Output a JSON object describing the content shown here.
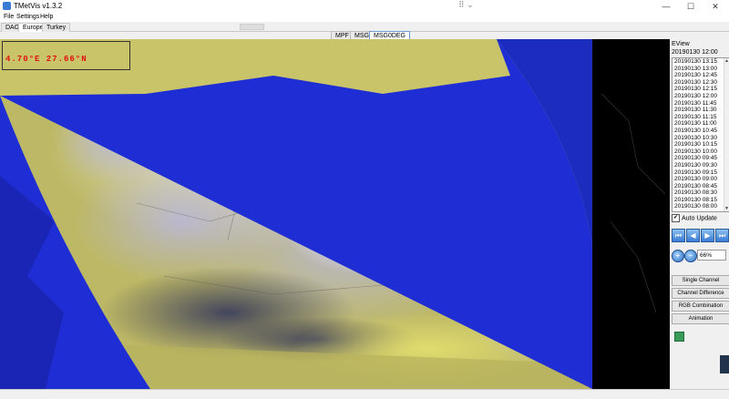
{
  "window": {
    "title": "TMetVis v1.3.2",
    "grip_glyph": "⠿ ⌄",
    "controls": {
      "minimize": "—",
      "maximize": "☐",
      "close": "✕"
    }
  },
  "menu": {
    "items": [
      "File",
      "Settings",
      "Help"
    ]
  },
  "region_tabs": {
    "items": [
      "DAG",
      "Europe",
      "Turkey"
    ],
    "active": "Europe"
  },
  "source_tabs": {
    "items": [
      "MPF",
      "MSG",
      "MSG0DEG"
    ],
    "active": "MSG0DEG"
  },
  "map": {
    "coordinate_readout": "4.70°E 27.66°N",
    "colors": {
      "space": "#000000",
      "cold_ocean": "#1a2fd4",
      "land_yellow": "#c8c46a",
      "cloud_white": "#f2f2ff"
    }
  },
  "panel": {
    "view_label": "EView",
    "current_time": "20190130 12:00",
    "time_list": [
      "20190130 13:15",
      "20190130 13:00",
      "20190130 12:45",
      "20190130 12:30",
      "20190130 12:15",
      "20190130 12:00",
      "20190130 11:45",
      "20190130 11:30",
      "20190130 11:15",
      "20190130 11:00",
      "20190130 10:45",
      "20190130 10:30",
      "20190130 10:15",
      "20190130 10:00",
      "20190130 09:45",
      "20190130 09:30",
      "20190130 09:15",
      "20190130 09:00",
      "20190130 08:45",
      "20190130 08:30",
      "20190130 08:15",
      "20190130 08:00"
    ],
    "auto_update_label": "Auto Update",
    "auto_update_checked": "✔",
    "nav": {
      "first": "⏮",
      "prev": "◀",
      "next": "▶",
      "last": "⏭"
    },
    "zoom": {
      "in": "+",
      "out": "−",
      "level": "66%"
    },
    "buttons": {
      "single_channel": "Single Channel",
      "channel_difference": "Channel Difference",
      "rgb_combination": "RGB Combination",
      "animation": "Animation"
    }
  }
}
